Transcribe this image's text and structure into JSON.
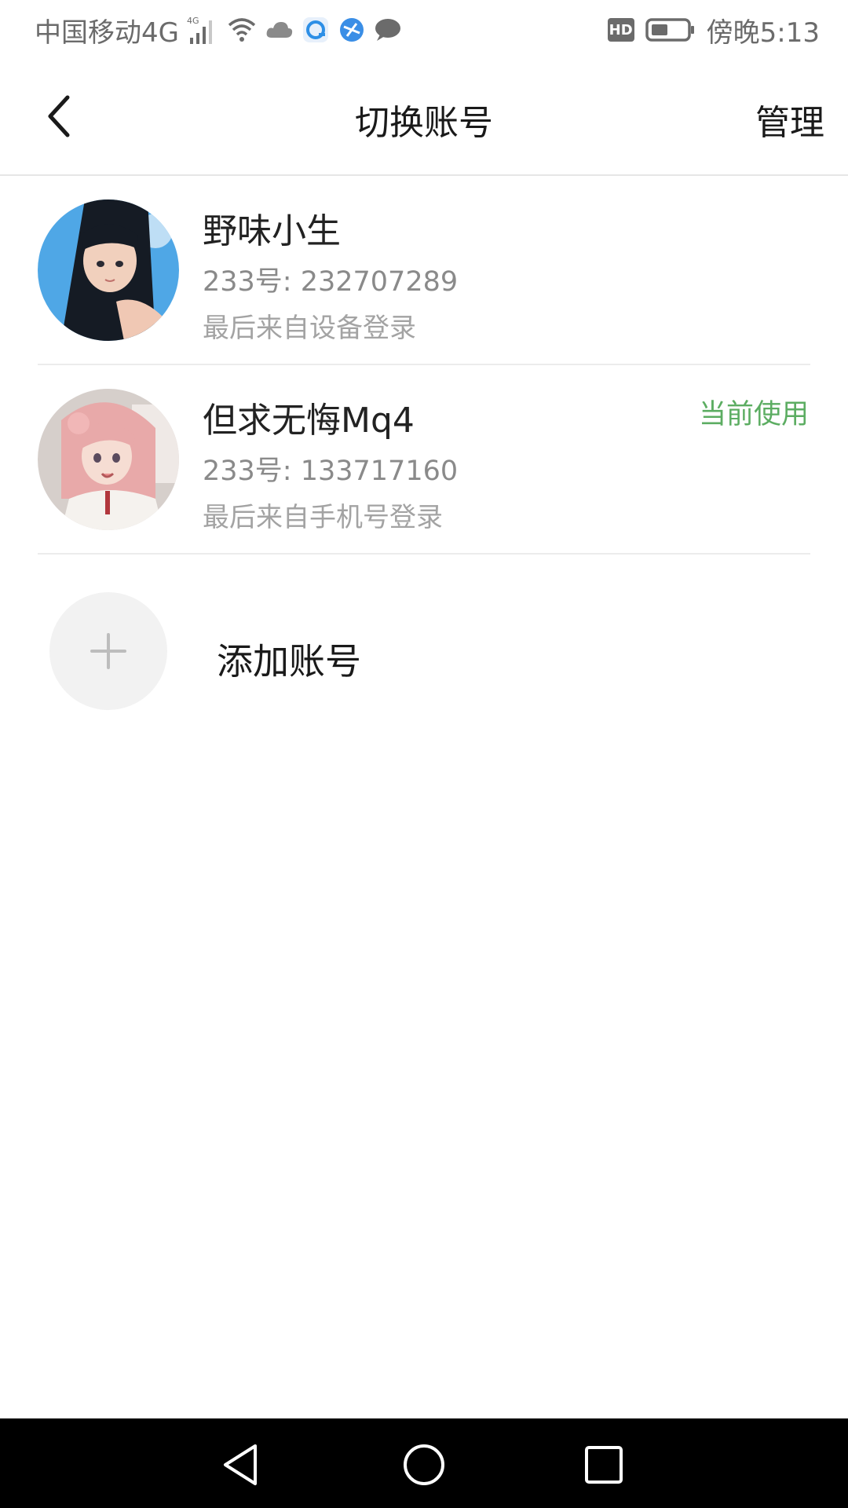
{
  "status_bar": {
    "carrier": "中国移动4G",
    "network_badge": "4G",
    "hd_label": "HD",
    "time": "傍晚5:13",
    "icons": [
      "signal-icon",
      "wifi-icon",
      "cloud-icon",
      "app-notification-icon",
      "browser-icon",
      "message-icon",
      "battery-icon"
    ]
  },
  "top_bar": {
    "title": "切换账号",
    "manage_label": "管理"
  },
  "accounts": [
    {
      "name": "野味小生",
      "id": "233号: 232707289",
      "login": "最后来自设备登录",
      "current_label": "",
      "avatar": "avatar-dark-hair-girl"
    },
    {
      "name": "但求无悔Mq4",
      "id": "233号: 133717160",
      "login": "最后来自手机号登录",
      "current_label": "当前使用",
      "avatar": "avatar-pink-hair-girl"
    }
  ],
  "add_account": {
    "label": "添加账号"
  },
  "colors": {
    "accent_green": "#5cad62",
    "text_primary": "#222222",
    "text_secondary": "#8a8a8a",
    "nav_bar": "#000000"
  }
}
